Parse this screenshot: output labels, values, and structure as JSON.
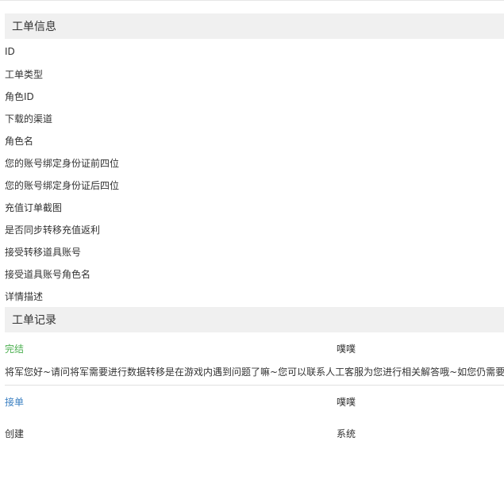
{
  "ticket_info": {
    "title": "工单信息",
    "fields": [
      "ID",
      "工单类型",
      "角色ID",
      "下载的渠道",
      "角色名",
      "您的账号绑定身份证前四位",
      "您的账号绑定身份证后四位",
      "充值订单截图",
      "是否同步转移充值返利",
      "接受转移道具账号",
      "接受道具账号角色名",
      "详情描述"
    ]
  },
  "ticket_records": {
    "title": "工单记录",
    "records": [
      {
        "status": "完结",
        "status_color": "#4caf50",
        "user": "噗噗",
        "message": "将军您好~请问将军需要进行数据转移是在游戏内遇到问题了嘛~您可以联系人工客服为您进行相关解答哦~如您仍需要进行数据转移，请您提供更多信息"
      },
      {
        "status": "接单",
        "status_color": "#3a7fc1",
        "user": "噗噗",
        "message": ""
      },
      {
        "status": "创建",
        "status_color": "#333333",
        "user": "系统",
        "message": ""
      }
    ]
  }
}
